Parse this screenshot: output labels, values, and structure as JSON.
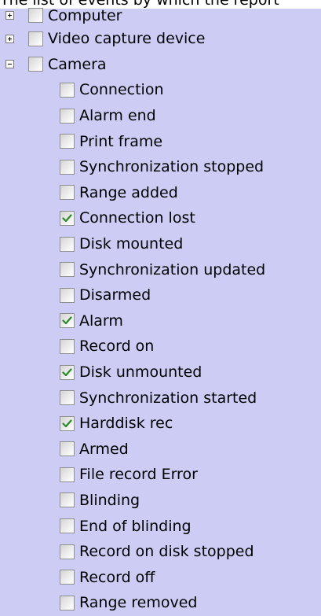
{
  "header_text": "The list of events by which the report",
  "tree": {
    "top_nodes": [
      {
        "label": "Computer",
        "expanded": false,
        "checked": false
      },
      {
        "label": "Video capture device",
        "expanded": false,
        "checked": false
      },
      {
        "label": "Camera",
        "expanded": true,
        "checked": false
      }
    ],
    "camera_events": [
      {
        "label": "Connection",
        "checked": false
      },
      {
        "label": "Alarm end",
        "checked": false
      },
      {
        "label": "Print frame",
        "checked": false
      },
      {
        "label": "Synchronization stopped",
        "checked": false
      },
      {
        "label": "Range added",
        "checked": false
      },
      {
        "label": "Connection lost",
        "checked": true
      },
      {
        "label": "Disk mounted",
        "checked": false
      },
      {
        "label": "Synchronization updated",
        "checked": false
      },
      {
        "label": "Disarmed",
        "checked": false
      },
      {
        "label": "Alarm",
        "checked": true
      },
      {
        "label": "Record on",
        "checked": false
      },
      {
        "label": "Disk unmounted",
        "checked": true
      },
      {
        "label": "Synchronization started",
        "checked": false
      },
      {
        "label": "Harddisk rec",
        "checked": true
      },
      {
        "label": "Armed",
        "checked": false
      },
      {
        "label": "File record Error",
        "checked": false
      },
      {
        "label": "Blinding",
        "checked": false
      },
      {
        "label": "End of blinding",
        "checked": false
      },
      {
        "label": "Record on disk stopped",
        "checked": false
      },
      {
        "label": "Record off",
        "checked": false
      },
      {
        "label": "Range removed",
        "checked": false
      }
    ]
  },
  "colors": {
    "background": "#ccccf5",
    "checkmark": "#2a8a2a"
  }
}
